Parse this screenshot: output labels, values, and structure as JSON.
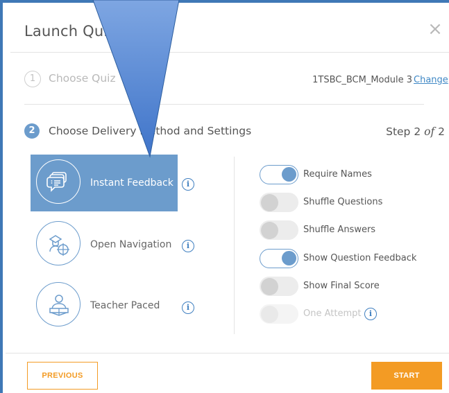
{
  "modal": {
    "title": "Launch Quiz",
    "close_glyph": "×"
  },
  "step1": {
    "number": "1",
    "label": "Choose Quiz",
    "quiz_name": "1TSBC_BCM_Module 3",
    "change_label": "Change"
  },
  "step2": {
    "number": "2",
    "label": "Choose Delivery Method and Settings",
    "step_prefix": "Step 2 ",
    "step_of": "of",
    "step_suffix": " 2"
  },
  "methods": [
    {
      "label": "Instant Feedback",
      "icon": "instant-feedback-icon",
      "selected": true
    },
    {
      "label": "Open Navigation",
      "icon": "open-navigation-icon",
      "selected": false
    },
    {
      "label": "Teacher Paced",
      "icon": "teacher-paced-icon",
      "selected": false
    }
  ],
  "info_glyph": "i",
  "settings": [
    {
      "label": "Require Names",
      "state": "on"
    },
    {
      "label": "Shuffle Questions",
      "state": "off"
    },
    {
      "label": "Shuffle Answers",
      "state": "off"
    },
    {
      "label": "Show Question Feedback",
      "state": "on"
    },
    {
      "label": "Show Final Score",
      "state": "off"
    },
    {
      "label": "One Attempt",
      "state": "disabled"
    }
  ],
  "footer": {
    "previous_label": "PREVIOUS",
    "start_label": "START"
  },
  "colors": {
    "accent_blue": "#6c9ccc",
    "frame_blue": "#3f78b6",
    "orange": "#f39b24",
    "overlay_arrow": "#4f86d4"
  }
}
